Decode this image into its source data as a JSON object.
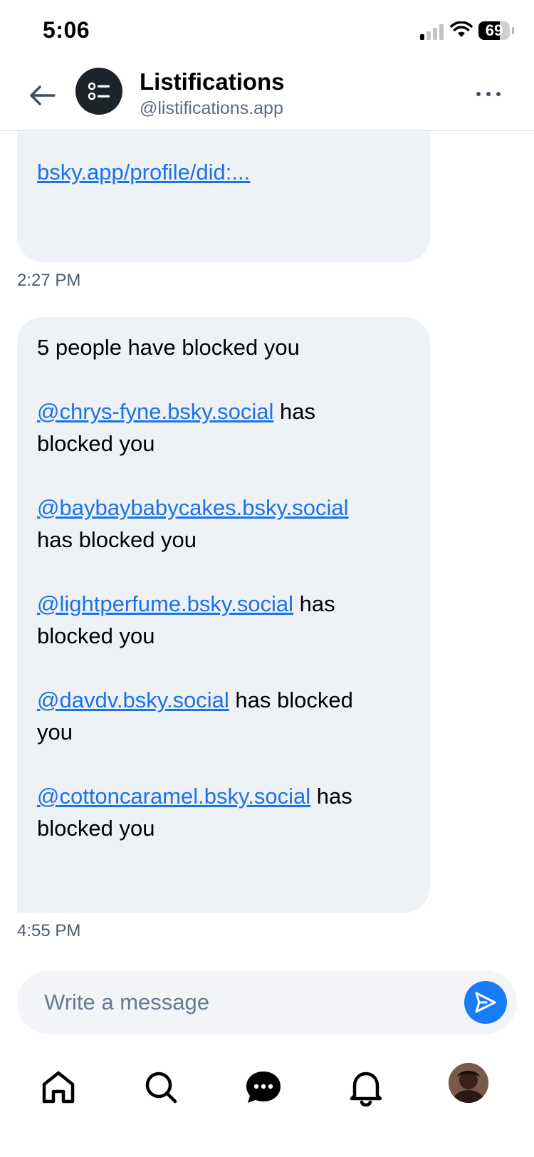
{
  "status_bar": {
    "time": "5:06",
    "battery_level": "69",
    "battery_fraction": 0.69,
    "signal_bars_active": 1,
    "signal_bars_total": 4
  },
  "header": {
    "name": "Listifications",
    "handle": "@listifications.app"
  },
  "messages": [
    {
      "link_text": "bsky.app/profile/did:...",
      "time": "2:27 PM"
    },
    {
      "intro": "5 people have blocked you",
      "blocks": [
        {
          "handle": "@chrys-fyne.bsky.social",
          "line1_suffix": " has",
          "line2": "blocked you"
        },
        {
          "handle": "@baybaybabycakes.bsky.social",
          "line1_suffix": "",
          "line2": "has blocked you"
        },
        {
          "handle": "@lightperfume.bsky.social",
          "line1_suffix": " has",
          "line2": "blocked you"
        },
        {
          "handle": "@davdv.bsky.social",
          "line1_suffix": " has blocked",
          "line2": "you"
        },
        {
          "handle": "@cottoncaramel.bsky.social",
          "line1_suffix": " has",
          "line2": "blocked you"
        }
      ],
      "time": "4:55 PM"
    }
  ],
  "composer": {
    "placeholder": "Write a message",
    "value": ""
  },
  "nav": {
    "items": [
      "home-icon",
      "search-icon",
      "chat-icon",
      "bell-icon",
      "profile-avatar"
    ]
  },
  "colors": {
    "link": "#1a73e8",
    "bubble": "#eef1f5",
    "send": "#1a7cf5",
    "muted": "#5b6b80"
  }
}
